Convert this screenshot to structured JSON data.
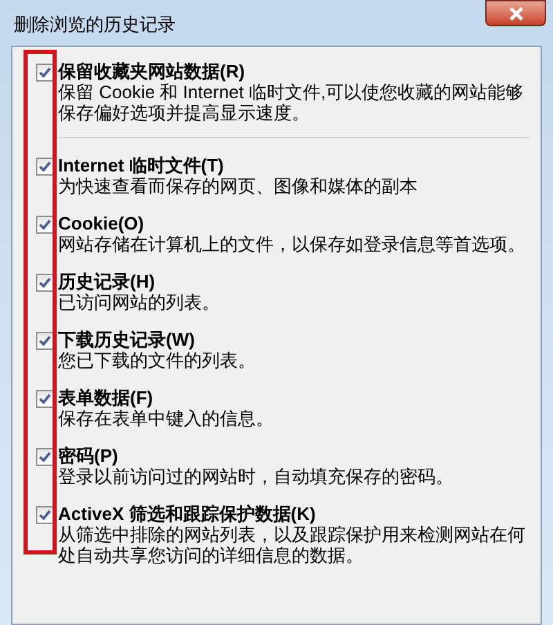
{
  "window": {
    "title": "删除浏览的历史记录"
  },
  "options": [
    {
      "title": "保留收藏夹网站数据(R)",
      "description": "保留 Cookie 和 Internet 临时文件,可以使您收藏的网站能够保存偏好选项并提高显示速度。",
      "checked": true
    },
    {
      "title": "Internet 临时文件(T)",
      "description": "为快速查看而保存的网页、图像和媒体的副本",
      "checked": true
    },
    {
      "title": "Cookie(O)",
      "description": "网站存储在计算机上的文件，以保存如登录信息等首选项。",
      "checked": true
    },
    {
      "title": "历史记录(H)",
      "description": "已访问网站的列表。",
      "checked": true
    },
    {
      "title": "下载历史记录(W)",
      "description": "您已下载的文件的列表。",
      "checked": true
    },
    {
      "title": "表单数据(F)",
      "description": "保存在表单中键入的信息。",
      "checked": true
    },
    {
      "title": "密码(P)",
      "description": "登录以前访问过的网站时，自动填充保存的密码。",
      "checked": true
    },
    {
      "title": "ActiveX 筛选和跟踪保护数据(K)",
      "description": "从筛选中排除的网站列表，以及跟踪保护用来检测网站在何处自动共享您访问的详细信息的数据。",
      "checked": true
    }
  ]
}
